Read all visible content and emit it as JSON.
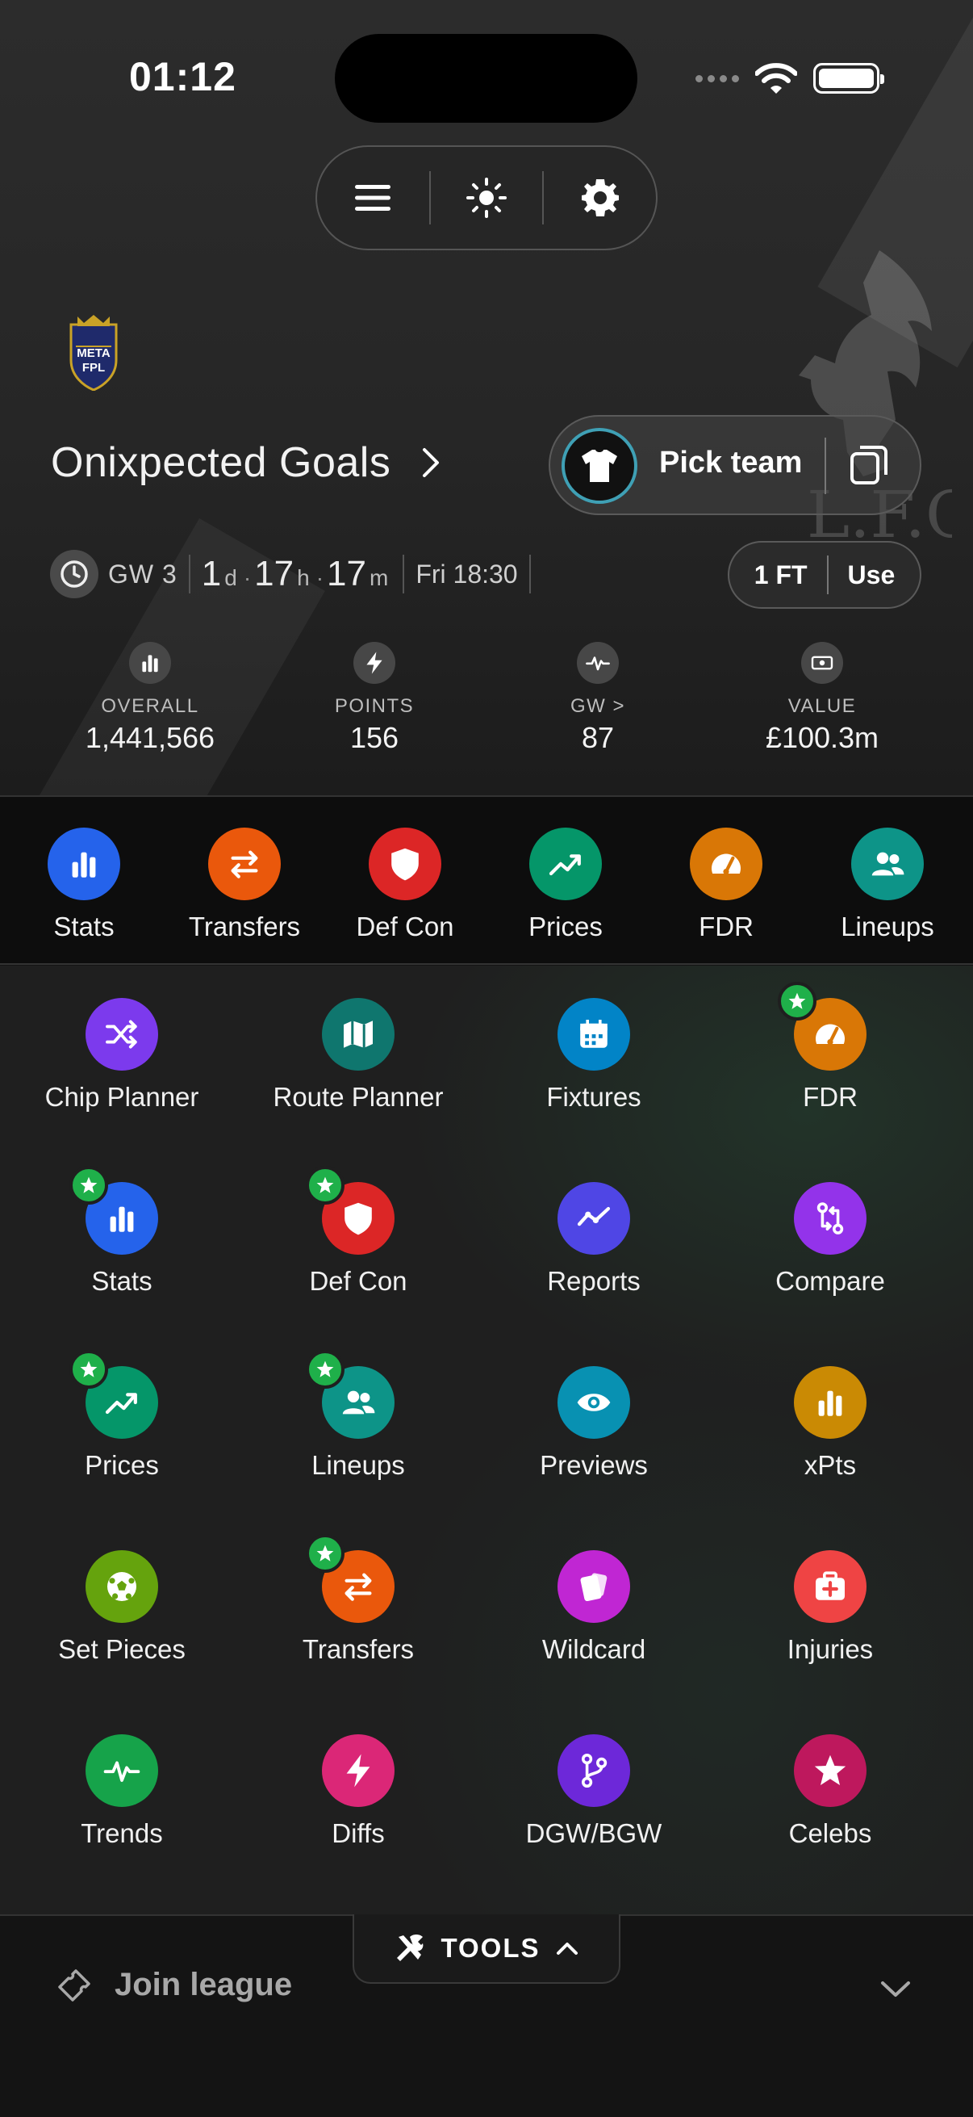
{
  "status_bar": {
    "time": "01:12"
  },
  "team": {
    "name": "Onixpected Goals",
    "logo_text_top": "META",
    "logo_text_bottom": "FPL"
  },
  "pick_team": {
    "label": "Pick team"
  },
  "gameweek": {
    "label": "GW 3",
    "countdown": {
      "days": "1",
      "days_unit": "d",
      "hours": "17",
      "hours_unit": "h",
      "minutes": "17",
      "minutes_unit": "m"
    },
    "deadline": "Fri 18:30"
  },
  "free_transfers": {
    "count_label": "1 FT",
    "use_label": "Use"
  },
  "stats": [
    {
      "label": "OVERALL",
      "value": "1,441,566",
      "icon": "bar-chart-icon"
    },
    {
      "label": "POINTS",
      "value": "156",
      "icon": "bolt-icon"
    },
    {
      "label": "GW >",
      "value": "87",
      "icon": "pulse-icon"
    },
    {
      "label": "VALUE",
      "value": "£100.3m",
      "icon": "money-icon"
    }
  ],
  "quick_nav": [
    {
      "label": "Stats",
      "color": "#2563eb",
      "icon": "bar-chart-icon"
    },
    {
      "label": "Transfers",
      "color": "#ea580c",
      "icon": "swap-icon"
    },
    {
      "label": "Def Con",
      "color": "#dc2626",
      "icon": "shield-icon"
    },
    {
      "label": "Prices",
      "color": "#059669",
      "icon": "trending-up-icon"
    },
    {
      "label": "FDR",
      "color": "#d97706",
      "icon": "gauge-icon"
    },
    {
      "label": "Lineups",
      "color": "#0d9488",
      "icon": "users-icon"
    }
  ],
  "tools": [
    {
      "label": "Chip Planner",
      "color": "#7c3aed",
      "icon": "shuffle-icon",
      "starred": false
    },
    {
      "label": "Route Planner",
      "color": "#0f766e",
      "icon": "map-icon",
      "starred": false
    },
    {
      "label": "Fixtures",
      "color": "#0284c7",
      "icon": "calendar-icon",
      "starred": false
    },
    {
      "label": "FDR",
      "color": "#d97706",
      "icon": "gauge-icon",
      "starred": true
    },
    {
      "label": "Stats",
      "color": "#2563eb",
      "icon": "bar-chart-icon",
      "starred": true
    },
    {
      "label": "Def Con",
      "color": "#dc2626",
      "icon": "shield-icon",
      "starred": true
    },
    {
      "label": "Reports",
      "color": "#4f46e5",
      "icon": "line-chart-icon",
      "starred": false
    },
    {
      "label": "Compare",
      "color": "#9333ea",
      "icon": "compare-icon",
      "starred": false
    },
    {
      "label": "Prices",
      "color": "#059669",
      "icon": "trending-up-icon",
      "starred": true
    },
    {
      "label": "Lineups",
      "color": "#0d9488",
      "icon": "users-icon",
      "starred": true
    },
    {
      "label": "Previews",
      "color": "#0891b2",
      "icon": "eye-icon",
      "starred": false
    },
    {
      "label": "xPts",
      "color": "#ca8a04",
      "icon": "bar-chart-icon",
      "starred": false
    },
    {
      "label": "Set Pieces",
      "color": "#65a30d",
      "icon": "football-icon",
      "starred": false
    },
    {
      "label": "Transfers",
      "color": "#ea580c",
      "icon": "swap-icon",
      "starred": true
    },
    {
      "label": "Wildcard",
      "color": "#c026d3",
      "icon": "cards-icon",
      "starred": false
    },
    {
      "label": "Injuries",
      "color": "#ef4444",
      "icon": "first-aid-icon",
      "starred": false
    },
    {
      "label": "Trends",
      "color": "#16a34a",
      "icon": "pulse-icon",
      "starred": false
    },
    {
      "label": "Diffs",
      "color": "#db2777",
      "icon": "bolt-icon",
      "starred": false
    },
    {
      "label": "DGW/BGW",
      "color": "#6d28d9",
      "icon": "git-branch-icon",
      "starred": false
    },
    {
      "label": "Celebs",
      "color": "#be185d",
      "icon": "star-icon",
      "starred": false
    }
  ],
  "tools_toggle": {
    "label": "TOOLS"
  },
  "join_league": {
    "label": "Join league"
  }
}
